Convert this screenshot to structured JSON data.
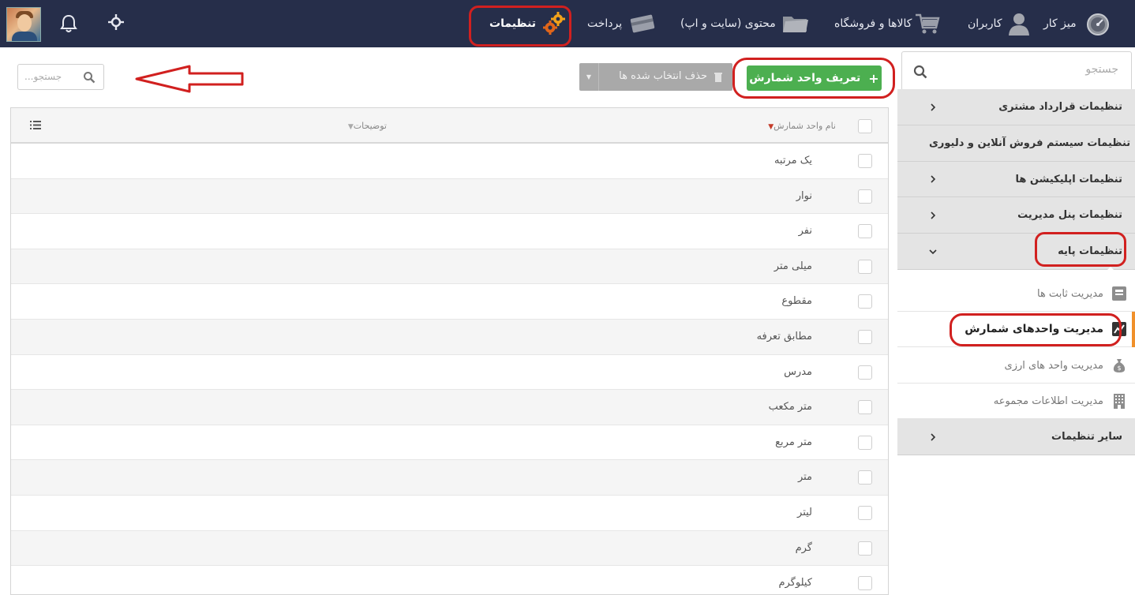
{
  "topnav": {
    "items": [
      {
        "label": "میز کار",
        "icon": "dashboard-gauge-icon"
      },
      {
        "label": "کاربران",
        "icon": "user-icon"
      },
      {
        "label": "کالاها و فروشگاه",
        "icon": "shopping-cart-icon"
      },
      {
        "label": "محتوی (سایت و اپ)",
        "icon": "folder-icon"
      },
      {
        "label": "پرداخت",
        "icon": "credit-card-icon"
      },
      {
        "label": "تنظیمات",
        "icon": "gears-icon"
      }
    ],
    "active": "تنظیمات"
  },
  "sidebar": {
    "search_placeholder": "جستجو",
    "sections": [
      {
        "label": "تنظیمات قرارداد مشتری"
      },
      {
        "label": "تنظیمات سیستم فروش آنلاین و دلیوری"
      },
      {
        "label": "تنظیمات اپلیکیشن ها"
      },
      {
        "label": "تنظیمات پنل مدیریت"
      },
      {
        "label": "تنظیمات پایه",
        "expanded": true
      },
      {
        "label": "سایر تنظیمات"
      }
    ],
    "subitems": [
      {
        "label": "مدیریت ثابت ها",
        "icon": "constants-icon"
      },
      {
        "label": "مدیریت واحدهای شمارش",
        "icon": "chart-icon",
        "active": true
      },
      {
        "label": "مدیریت واحد های ارزی",
        "icon": "money-bag-icon"
      },
      {
        "label": "مدیریت اطلاعات مجموعه",
        "icon": "building-icon"
      }
    ]
  },
  "toolbar": {
    "search_placeholder": "جستجو...",
    "delete_label": "حذف انتخاب شده ها",
    "add_label": "تعریف واحد شمارش",
    "add_color": "#4caf50"
  },
  "table": {
    "columns": [
      "نام واحد شمارش",
      "توضیحات"
    ],
    "rows": [
      "یک مرتبه",
      "نوار",
      "نفر",
      "میلی متر",
      "مقطوع",
      "مطابق تعرفه",
      "مدرس",
      "متر مکعب",
      "متر مربع",
      "متر",
      "لیتر",
      "گرم",
      "کیلوگرم"
    ]
  },
  "annotations": {
    "highlight_color": "#d1201f"
  }
}
